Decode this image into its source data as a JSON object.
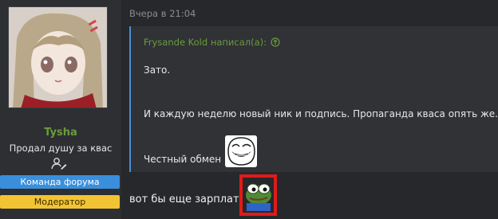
{
  "author": {
    "username": "Tysha",
    "user_title": "Продал душу за квас",
    "banners": {
      "team": "Команда форума",
      "moderator": "Модератор"
    }
  },
  "message": {
    "date": "Вчера в 21:04",
    "quote": {
      "author_line": "Frysande Kold написал(а):",
      "line1": "Зато.",
      "line2": "И каждую неделю новый ник и подпись. Пропаганда кваса опять же.",
      "line3": "Честный обмен"
    },
    "reply": "вот бы еще зарплату"
  },
  "colors": {
    "username": "#6c9b3c",
    "team_banner": "#3a8fdc",
    "moderator_banner": "#f2c433",
    "quote_border": "#4a8fd6",
    "highlight": "#e21a1a"
  },
  "icons": {
    "user_edit": "user-edit-icon",
    "quote_jump": "arrow-up-circle-icon"
  }
}
